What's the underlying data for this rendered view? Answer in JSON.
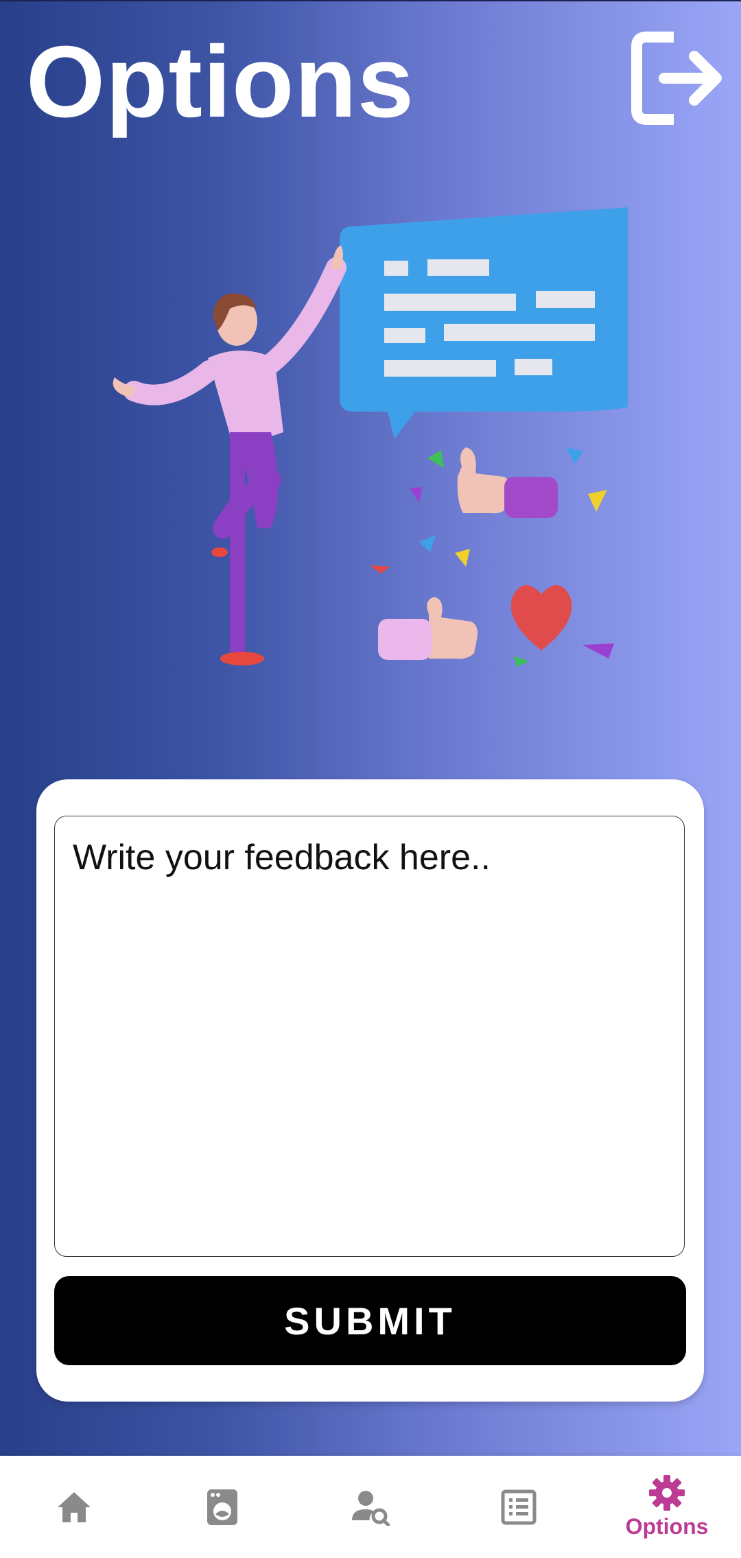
{
  "header": {
    "title": "Options",
    "logout_icon": "logout-icon"
  },
  "feedback": {
    "placeholder": "Write your feedback here..",
    "value": ""
  },
  "actions": {
    "submit_label": "SUBMIT"
  },
  "bottom_nav": {
    "items": [
      {
        "icon": "home-icon",
        "label": "",
        "active": false
      },
      {
        "icon": "washing-machine-icon",
        "label": "",
        "active": false
      },
      {
        "icon": "user-search-icon",
        "label": "",
        "active": false
      },
      {
        "icon": "list-icon",
        "label": "",
        "active": false
      },
      {
        "icon": "gear-icon",
        "label": "Options",
        "active": true
      }
    ],
    "active_color": "#bc3b94",
    "inactive_color": "#8a8a8a"
  },
  "colors": {
    "gradient_start": "#283f8a",
    "gradient_end": "#9ba6f7",
    "button_bg": "#000000"
  }
}
